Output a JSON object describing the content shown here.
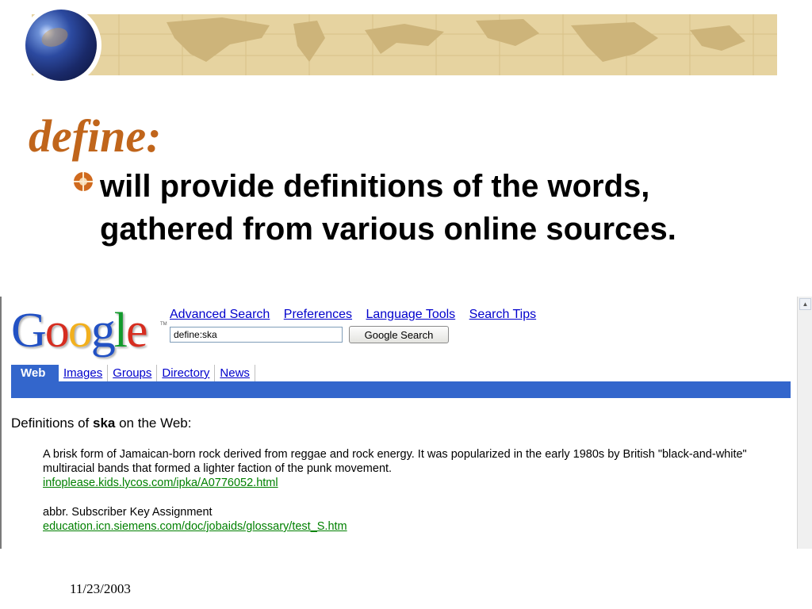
{
  "slide": {
    "title": "define:",
    "bullet": "will provide definitions of the words, gathered from various online sources.",
    "date": "11/23/2003"
  },
  "google": {
    "logo_letters": [
      "G",
      "o",
      "o",
      "g",
      "l",
      "e"
    ],
    "logo_colors": [
      "#2251c4",
      "#d62d20",
      "#f2b01e",
      "#2251c4",
      "#129a2c",
      "#d62d20"
    ],
    "top_links": [
      "Advanced Search",
      "Preferences",
      "Language Tools",
      "Search Tips"
    ],
    "search_value": "define:ska",
    "search_button": "Google Search",
    "tabs": [
      "Web",
      "Images",
      "Groups",
      "Directory",
      "News"
    ],
    "active_tab": "Web",
    "tab_bar_color": "#3366cc",
    "heading_prefix": "Definitions of ",
    "heading_term": "ska",
    "heading_suffix": " on the Web:",
    "definitions": [
      {
        "text": "A brisk form of Jamaican-born rock derived from reggae and rock energy. It was popularized in the early 1980s by British \"black-and-white\" multiracial bands that formed a lighter faction of the punk movement.",
        "source": "infoplease.kids.lycos.com/ipka/A0776052.html"
      },
      {
        "text": "abbr. Subscriber Key Assignment",
        "source": "education.icn.siemens.com/doc/jobaids/glossary/test_S.htm"
      }
    ]
  },
  "colors": {
    "title": "#c0651b",
    "banner": "#e6d3a0",
    "link": "#0000cc",
    "source_link": "#008000"
  }
}
